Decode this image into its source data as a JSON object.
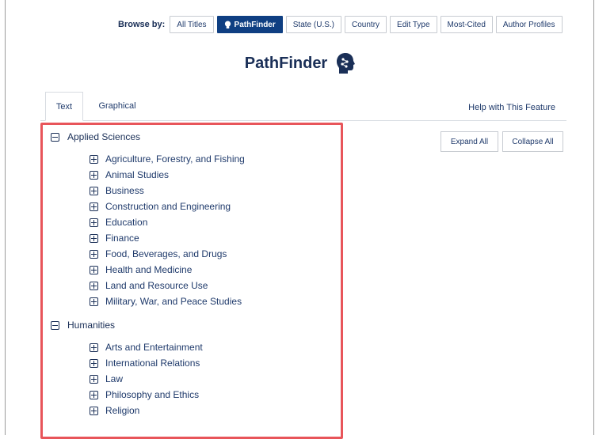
{
  "browse": {
    "label": "Browse by:",
    "buttons": [
      {
        "label": "All Titles",
        "active": false
      },
      {
        "label": "PathFinder",
        "active": true
      },
      {
        "label": "State (U.S.)",
        "active": false
      },
      {
        "label": "Country",
        "active": false
      },
      {
        "label": "Edit Type",
        "active": false
      },
      {
        "label": "Most-Cited",
        "active": false
      },
      {
        "label": "Author Profiles",
        "active": false
      }
    ]
  },
  "page": {
    "title": "PathFinder",
    "icon": "head-network-icon"
  },
  "tabs": [
    {
      "label": "Text",
      "active": true
    },
    {
      "label": "Graphical",
      "active": false
    }
  ],
  "help_link": "Help with This Feature",
  "actions": {
    "expand_all": "Expand All",
    "collapse_all": "Collapse All"
  },
  "tree": [
    {
      "label": "Applied Sciences",
      "expanded": true,
      "children": [
        "Agriculture, Forestry, and Fishing",
        "Animal Studies",
        "Business",
        "Construction and Engineering",
        "Education",
        "Finance",
        "Food, Beverages, and Drugs",
        "Health and Medicine",
        "Land and Resource Use",
        "Military, War, and Peace Studies"
      ]
    },
    {
      "label": "Humanities",
      "expanded": true,
      "children": [
        "Arts and Entertainment",
        "International Relations",
        "Law",
        "Philosophy and Ethics",
        "Religion"
      ]
    }
  ],
  "colors": {
    "accent": "#0f3f82",
    "highlight": "#e8555a",
    "text": "#1f3a6b"
  }
}
